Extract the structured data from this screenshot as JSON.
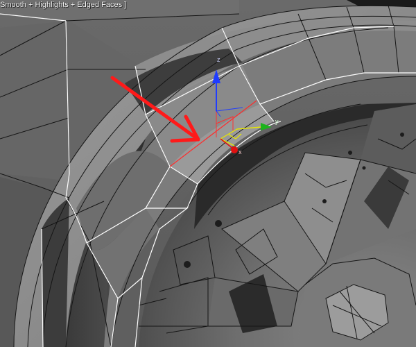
{
  "app": {
    "name": "3D modeling viewport"
  },
  "viewport": {
    "label": "Smooth + Highlights + Edged Faces ]",
    "shading_mode": "Smooth + Highlights + Edged Faces",
    "background_color": "#5c5c5c"
  },
  "gizmo": {
    "type": "move",
    "axes": [
      {
        "name": "z",
        "color": "#1f3cff"
      },
      {
        "name": "y",
        "color": "#1db31d"
      },
      {
        "name": "x",
        "color": "#e01010"
      }
    ],
    "plane_color": "#e8e800"
  },
  "selection": {
    "edge_color": "#ff2a2a"
  },
  "annotation": {
    "arrow_color": "#ff1a1a",
    "arrow_icon": "red-arrow-pointer"
  },
  "colors": {
    "mesh_edge": "#111111",
    "selected_edge": "#ffffff",
    "surface_light": "#8a8a8a",
    "surface_dark": "#2f2f2f"
  }
}
